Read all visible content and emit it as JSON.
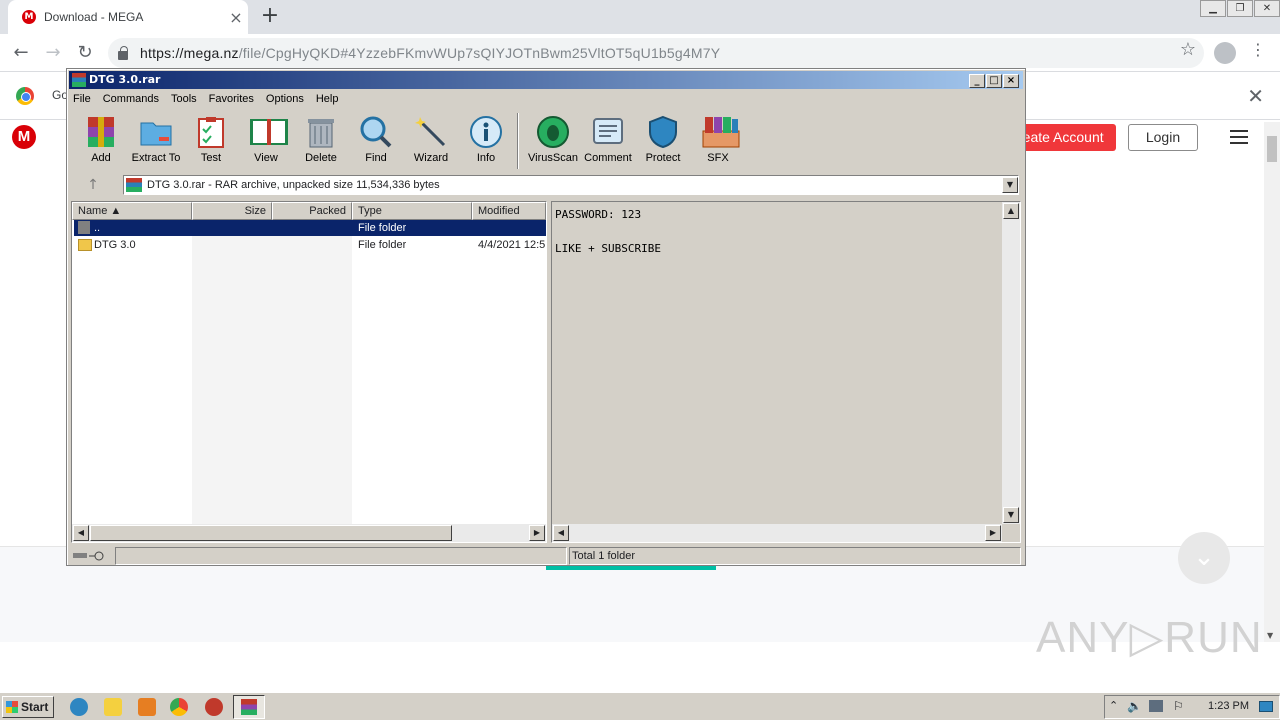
{
  "browser": {
    "tab_title": "Download - MEGA",
    "tab_favicon": "M",
    "url_host": "https://mega.nz",
    "url_rest": "/file/CpgHyQKD#4YzzebFKmvWUp7sQIYJOTnBwm25VltOT5qU1b5g4M7Y",
    "infobar_text": "Go"
  },
  "mega": {
    "logo": "M",
    "create_account": "reate Account",
    "login": "Login",
    "watermark": "ANY▷RUN"
  },
  "winrar": {
    "title": "DTG 3.0.rar",
    "menu": [
      "File",
      "Commands",
      "Tools",
      "Favorites",
      "Options",
      "Help"
    ],
    "tools": [
      "Add",
      "Extract To",
      "Test",
      "View",
      "Delete",
      "Find",
      "Wizard",
      "Info",
      "VirusScan",
      "Comment",
      "Protect",
      "SFX"
    ],
    "path_text": "DTG 3.0.rar - RAR archive, unpacked size 11,534,336 bytes",
    "columns": [
      "Name",
      "Size",
      "Packed",
      "Type",
      "Modified"
    ],
    "rows": [
      {
        "name": "..",
        "type": "File folder",
        "modified": ""
      },
      {
        "name": "DTG 3.0",
        "type": "File folder",
        "modified": "4/4/2021 12:5"
      }
    ],
    "comment_line1": "PASSWORD: 123",
    "comment_line2": "LIKE + SUBSCRIBE",
    "status": "Total 1 folder"
  },
  "taskbar": {
    "start": "Start",
    "clock": "1:23 PM"
  }
}
